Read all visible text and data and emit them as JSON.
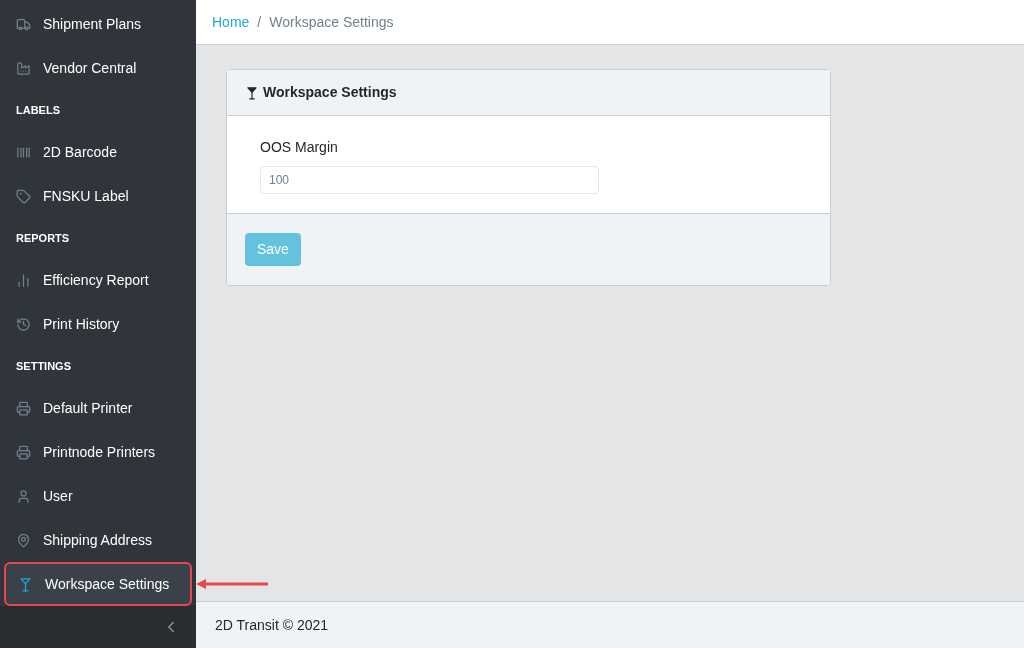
{
  "sidebar": {
    "items": [
      {
        "kind": "link",
        "label": "Shipment Plans",
        "selected": false
      },
      {
        "kind": "link",
        "label": "Vendor Central",
        "selected": false
      },
      {
        "kind": "header",
        "label": "LABELS"
      },
      {
        "kind": "link",
        "label": "2D Barcode",
        "selected": false
      },
      {
        "kind": "link",
        "label": "FNSKU Label",
        "selected": false
      },
      {
        "kind": "header",
        "label": "REPORTS"
      },
      {
        "kind": "link",
        "label": "Efficiency Report",
        "selected": false
      },
      {
        "kind": "link",
        "label": "Print History",
        "selected": false
      },
      {
        "kind": "header",
        "label": "SETTINGS"
      },
      {
        "kind": "link",
        "label": "Default Printer",
        "selected": false
      },
      {
        "kind": "link",
        "label": "Printnode Printers",
        "selected": false
      },
      {
        "kind": "link",
        "label": "User",
        "selected": false
      },
      {
        "kind": "link",
        "label": "Shipping Address",
        "selected": false
      },
      {
        "kind": "link",
        "label": "Workspace Settings",
        "selected": true
      }
    ]
  },
  "breadcrumb": [
    {
      "kind": "link",
      "label": "Home"
    },
    {
      "kind": "separator",
      "label": "/"
    },
    {
      "kind": "current",
      "label": "Workspace Settings"
    }
  ],
  "card": {
    "title": "Workspace Settings",
    "field": {
      "label": "OOS Margin",
      "placeholder": "100"
    },
    "button": "Save"
  },
  "footer": "2D Transit © 2021"
}
